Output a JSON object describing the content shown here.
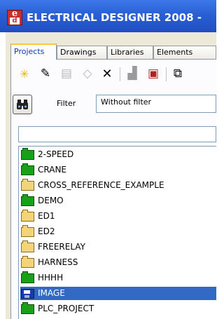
{
  "window": {
    "title": "ELECTRICAL DESIGNER 2008  -"
  },
  "tabs": [
    "Projects",
    "Drawings",
    "Libraries",
    "Elements"
  ],
  "filter": {
    "label": "Filter",
    "value": "Without filter"
  },
  "search": {
    "value": ""
  },
  "projects": [
    {
      "name": "2-SPEED",
      "icon": "green-folder-icon"
    },
    {
      "name": "CRANE",
      "icon": "green-folder-icon"
    },
    {
      "name": "CROSS_REFERENCE_EXAMPLE",
      "icon": "yellow-folder-icon"
    },
    {
      "name": "DEMO",
      "icon": "green-folder-icon"
    },
    {
      "name": "ED1",
      "icon": "yellow-folder-icon"
    },
    {
      "name": "ED2",
      "icon": "yellow-folder-icon"
    },
    {
      "name": "FREERELAY",
      "icon": "yellow-folder-icon"
    },
    {
      "name": "HARNESS",
      "icon": "yellow-folder-icon"
    },
    {
      "name": "HHHH",
      "icon": "green-folder-icon"
    },
    {
      "name": "IMAGE",
      "icon": "disk-icon",
      "selected": true
    },
    {
      "name": "PLC_PROJECT",
      "icon": "green-folder-icon"
    }
  ],
  "toolbar_icons": [
    "new-icon",
    "edit-icon",
    "print-icon",
    "eraser-icon",
    "delete-icon",
    "move-icon",
    "properties-icon",
    "copy-icon"
  ]
}
